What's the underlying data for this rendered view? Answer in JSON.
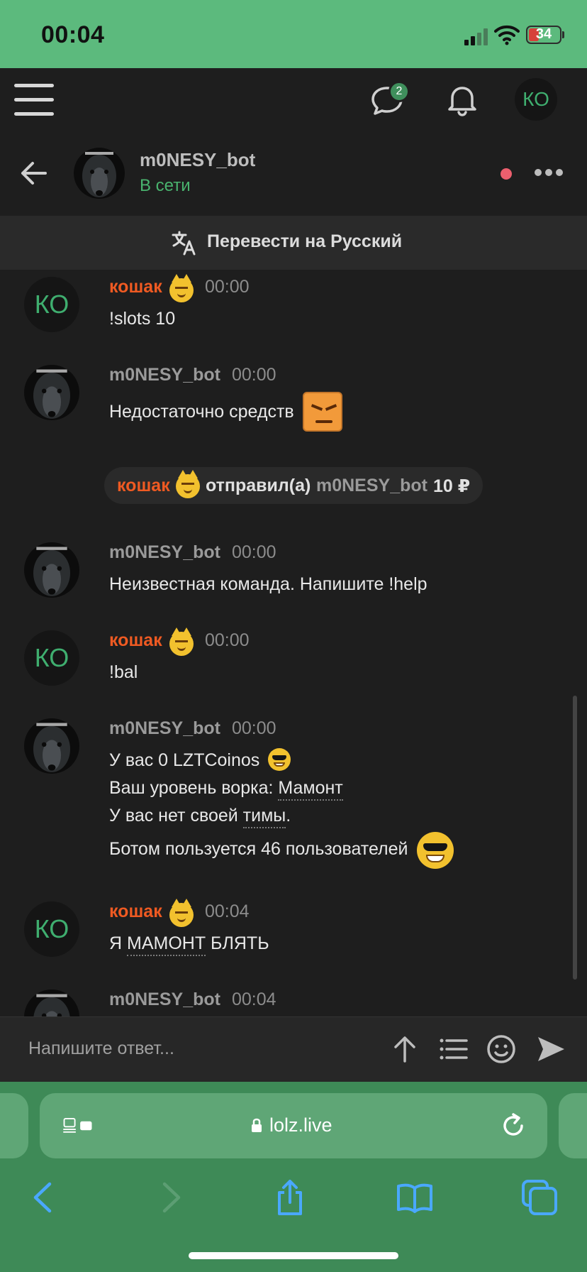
{
  "status_bar": {
    "time": "00:04",
    "battery": "34"
  },
  "nav": {
    "messages_badge": "2",
    "user_initials": "КО"
  },
  "chat_header": {
    "name": "m0NESY_bot",
    "status": "В сети"
  },
  "translate": {
    "label": "Перевести на Русский"
  },
  "messages": [
    {
      "author": "кошак",
      "time": "00:00",
      "text": "!slots 10"
    },
    {
      "author": "m0NESY_bot",
      "time": "00:00",
      "text": "Недостаточно средств"
    },
    {
      "author": "m0NESY_bot",
      "time": "00:00",
      "text": "Неизвестная команда. Напишите !help"
    },
    {
      "author": "кошак",
      "time": "00:00",
      "text": "!bal"
    },
    {
      "author": "m0NESY_bot",
      "time": "00:00",
      "line1": "У вас 0 LZTCoinos",
      "line2_prefix": "Ваш уровень ворка: ",
      "line2_link": "Мамонт",
      "line3_prefix": "У вас нет своей ",
      "line3_link": "тимы",
      "line3_suffix": ".",
      "line4": "Ботом пользуется 46 пользователей"
    },
    {
      "author": "кошак",
      "time": "00:04",
      "text_prefix": "Я ",
      "text_link": "МАМОНТ",
      "text_suffix": " БЛЯТЬ"
    },
    {
      "author": "m0NESY_bot",
      "time": "00:04"
    }
  ],
  "transfer": {
    "sender": "кошак",
    "action": "отправил(а)",
    "recipient": "m0NESY_bot",
    "amount": "10 ₽"
  },
  "composer": {
    "placeholder": "Напишите ответ..."
  },
  "browser": {
    "url": "lolz.live"
  },
  "colors": {
    "status_bar": "#5cba7d",
    "accent_green": "#49b36e",
    "orange_author": "#ef5a22",
    "browser_green": "#3e8a57"
  }
}
